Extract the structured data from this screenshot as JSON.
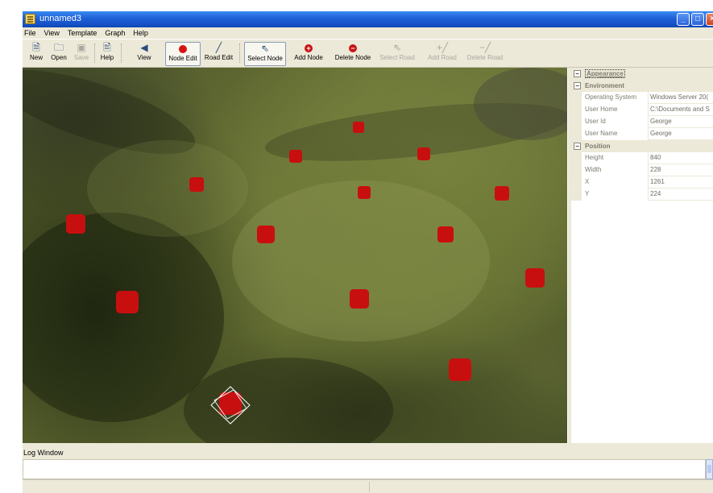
{
  "window": {
    "title": "unnamed3",
    "accent_color": "#1d5fd6"
  },
  "menu": [
    "File",
    "View",
    "Template",
    "Graph",
    "Help"
  ],
  "toolbar": {
    "new": {
      "label": "New",
      "icon": "new-file-icon"
    },
    "open": {
      "label": "Open",
      "icon": "open-folder-icon"
    },
    "save": {
      "label": "Save",
      "icon": "save-disk-icon",
      "enabled": false
    },
    "help": {
      "label": "Help",
      "icon": "help-icon"
    },
    "view": {
      "label": "View",
      "icon": "view-icon"
    },
    "node_edit": {
      "label": "Node Edit",
      "icon": "red-dot-icon",
      "pressed": true
    },
    "road_edit": {
      "label": "Road Edit",
      "icon": "pen-icon"
    },
    "select_node": {
      "label": "Select Node",
      "icon": "cursor-icon",
      "pressed": true
    },
    "add_node": {
      "label": "Add Node",
      "icon": "plus-circle-icon"
    },
    "delete_node": {
      "label": "Delete Node",
      "icon": "minus-circle-icon"
    },
    "select_road": {
      "label": "Select Road",
      "icon": "cursor-icon",
      "enabled": false
    },
    "add_road": {
      "label": "Add Road",
      "icon": "add-road-icon",
      "enabled": false
    },
    "delete_road": {
      "label": "Delete Road",
      "icon": "delete-road-icon",
      "enabled": false
    }
  },
  "viewport": {
    "node_color": "#c80f0f",
    "selected_node_index": 14
  },
  "properties": {
    "categories": [
      {
        "name": "Appearance",
        "selected": true,
        "rows": []
      },
      {
        "name": "Environment",
        "rows": [
          {
            "key": "Operating System",
            "value": "Windows Server 20("
          },
          {
            "key": "User Home",
            "value": "C:\\Documents and S"
          },
          {
            "key": "User Id",
            "value": "George"
          },
          {
            "key": "User Name",
            "value": "George"
          }
        ]
      },
      {
        "name": "Position",
        "rows": [
          {
            "key": "Height",
            "value": "840"
          },
          {
            "key": "Width",
            "value": "228"
          },
          {
            "key": "X",
            "value": "1261"
          },
          {
            "key": "Y",
            "value": "224"
          }
        ]
      }
    ]
  },
  "log": {
    "title": "Log Window"
  }
}
